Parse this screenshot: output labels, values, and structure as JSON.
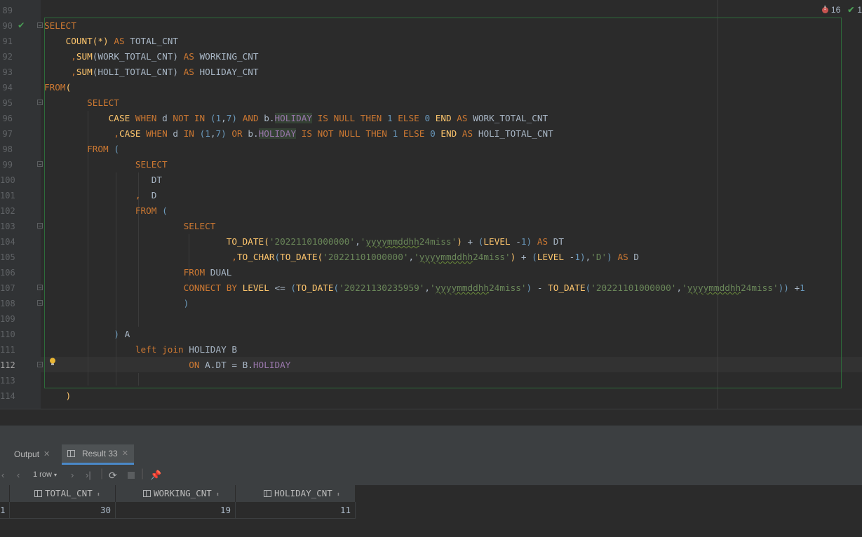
{
  "editor": {
    "line_numbers": [
      "89",
      "90",
      "91",
      "92",
      "93",
      "94",
      "95",
      "96",
      "97",
      "98",
      "99",
      "100",
      "101",
      "102",
      "103",
      "104",
      "105",
      "106",
      "107",
      "108",
      "109",
      "110",
      "111",
      "112",
      "113",
      "114"
    ],
    "inspections": {
      "errors": "16",
      "ok": "1"
    }
  },
  "tool_window": {
    "tabs": [
      {
        "label": "Output"
      },
      {
        "label": "Result 33"
      }
    ],
    "toolbar": {
      "row_count": "1 row"
    }
  },
  "result_grid": {
    "columns": [
      "TOTAL_CNT",
      "WORKING_CNT",
      "HOLIDAY_CNT"
    ],
    "rows": [
      {
        "row_no": "1",
        "values": [
          "30",
          "19",
          "11"
        ]
      }
    ]
  },
  "colors": {
    "keyword": "#cc7832",
    "function": "#ffc66d",
    "string": "#6a8759",
    "number": "#6897bb",
    "identifier": "#a9b7c6",
    "column": "#9876aa",
    "background": "#2b2b2b",
    "selection_border": "#2d6b3a"
  }
}
